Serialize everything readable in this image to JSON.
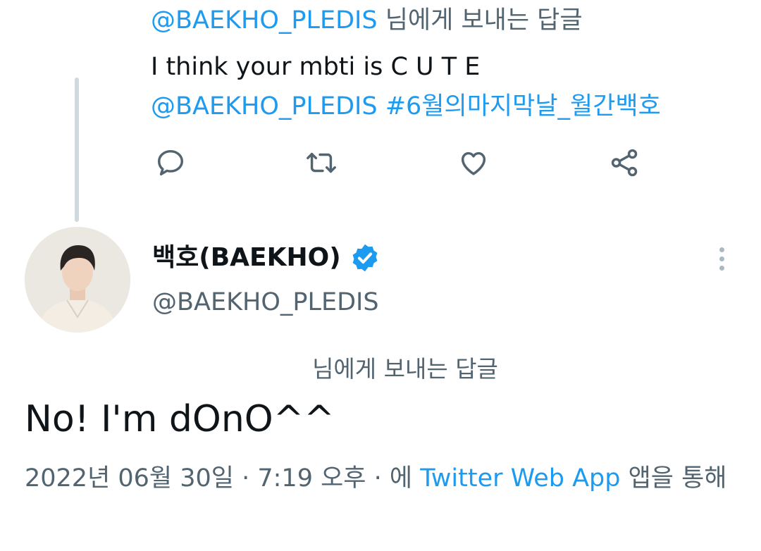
{
  "parent": {
    "replying_handle": "@BAEKHO_PLEDIS",
    "replying_suffix": " 님에게 보내는 답글",
    "text": "I think your mbti is C U T E",
    "tags": "@BAEKHO_PLEDIS #6월의마지막날_월간백호"
  },
  "actions": {
    "reply_icon": "reply-bubble-icon",
    "retweet_icon": "retweet-icon",
    "like_icon": "heart-icon",
    "share_icon": "share-icon"
  },
  "tweet": {
    "display_name": "백호(BAEKHO)",
    "handle": "@BAEKHO_PLEDIS",
    "replying_to": "님에게 보내는 답글",
    "text": "No! I'm dOnO^^",
    "date": "2022년 06월 30일 · 7:19 오후 · 에 ",
    "source": "Twitter Web App",
    "via_suffix": " 앱을 통해"
  },
  "colors": {
    "link": "#1d9bf0",
    "secondary_text": "#536471",
    "primary_text": "#0f1419",
    "thread_line": "#cfd9de",
    "verified_badge": "#1d9bf0"
  }
}
